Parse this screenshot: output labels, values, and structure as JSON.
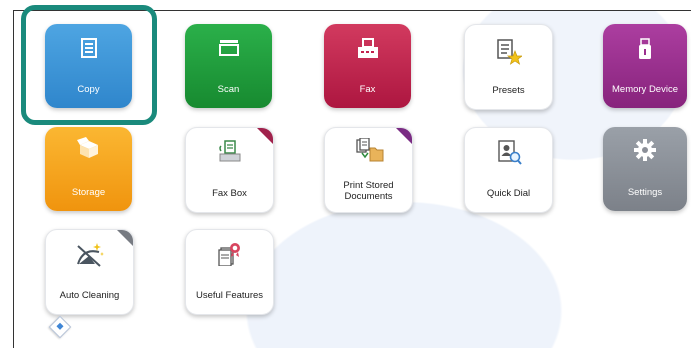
{
  "tiles": {
    "copy": {
      "label": "Copy"
    },
    "scan": {
      "label": "Scan"
    },
    "fax": {
      "label": "Fax"
    },
    "presets": {
      "label": "Presets"
    },
    "memory": {
      "label": "Memory Device"
    },
    "storage": {
      "label": "Storage"
    },
    "faxbox": {
      "label": "Fax Box"
    },
    "print_stored": {
      "label_line1": "Print Stored",
      "label_line2": "Documents"
    },
    "quickdial": {
      "label": "Quick Dial"
    },
    "settings": {
      "label": "Settings"
    },
    "autoclean": {
      "label": "Auto Cleaning"
    },
    "useful": {
      "label": "Useful Features"
    }
  },
  "colors": {
    "copy": "#3d96d8",
    "scan": "#1f9e3a",
    "fax": "#c4224e",
    "memory": "#9b2f8f",
    "storage": "#f7a51c",
    "settings": "#8b8f98",
    "focus": "#1a8a7c"
  },
  "icons": {
    "copy": "document-icon",
    "scan": "scanner-icon",
    "fax": "fax-machine-icon",
    "presets": "star-document-icon",
    "memory": "usb-drive-icon",
    "storage": "open-box-icon",
    "faxbox": "fax-tray-icon",
    "print_stored": "stored-documents-icon",
    "quickdial": "address-book-search-icon",
    "settings": "gear-icon",
    "autoclean": "cleaning-sparkle-icon",
    "useful": "features-badge-icon",
    "home": "home-diamond-icon"
  }
}
